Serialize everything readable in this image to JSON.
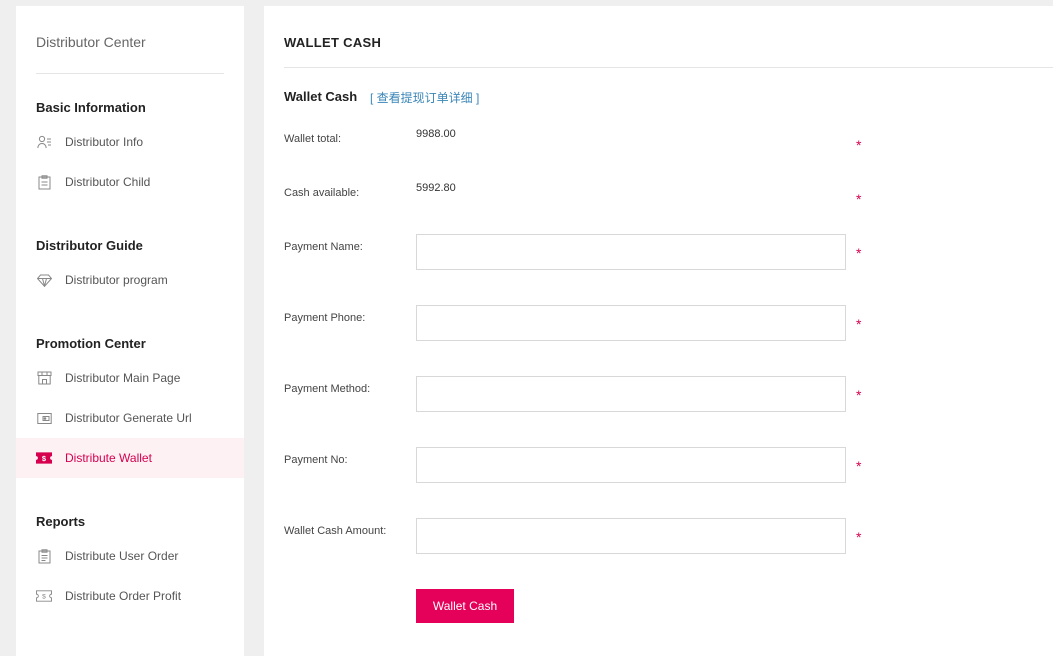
{
  "sidebar": {
    "title": "Distributor Center",
    "groups": [
      {
        "title": "Basic Information",
        "items": [
          {
            "label": "Distributor Info",
            "icon": "user-card-icon"
          },
          {
            "label": "Distributor Child",
            "icon": "clipboard-icon"
          }
        ]
      },
      {
        "title": "Distributor Guide",
        "items": [
          {
            "label": "Distributor program",
            "icon": "diamond-icon"
          }
        ]
      },
      {
        "title": "Promotion Center",
        "items": [
          {
            "label": "Distributor Main Page",
            "icon": "storefront-icon"
          },
          {
            "label": "Distributor Generate Url",
            "icon": "wallet-card-icon"
          },
          {
            "label": "Distribute Wallet",
            "icon": "dollar-ticket-icon",
            "active": true
          }
        ]
      },
      {
        "title": "Reports",
        "items": [
          {
            "label": "Distribute User Order",
            "icon": "clipboard-list-icon"
          },
          {
            "label": "Distribute Order Profit",
            "icon": "money-ticket-icon"
          }
        ]
      }
    ]
  },
  "main": {
    "header": "WALLET CASH",
    "section_title": "Wallet Cash",
    "section_link": "[ 查看提现订单详细 ]",
    "wallet_total": {
      "label": "Wallet total:",
      "value": "9988.00"
    },
    "cash_available": {
      "label": "Cash available:",
      "value": "5992.80"
    },
    "fields": {
      "payment_name": {
        "label": "Payment Name:",
        "value": ""
      },
      "payment_phone": {
        "label": "Payment Phone:",
        "value": ""
      },
      "payment_method": {
        "label": "Payment Method:",
        "value": ""
      },
      "payment_no": {
        "label": "Payment No:",
        "value": ""
      },
      "wallet_cash_amount": {
        "label": "Wallet Cash Amount:",
        "value": ""
      }
    },
    "required_mark": "*",
    "submit_label": "Wallet Cash"
  },
  "colors": {
    "accent": "#e5005a",
    "active_bg": "#fdf1f4",
    "link": "#3a86b8"
  }
}
